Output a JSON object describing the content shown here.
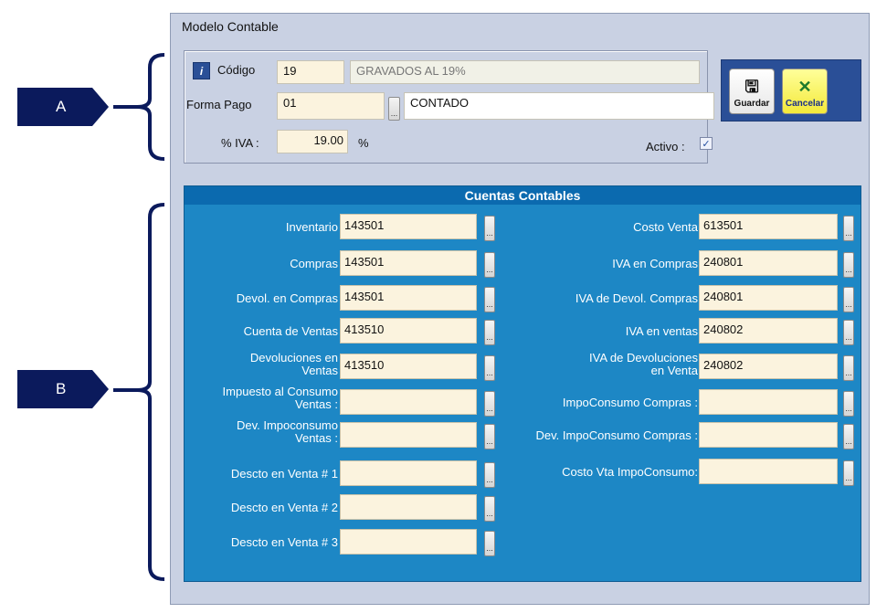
{
  "annotations": {
    "a": "A",
    "b": "B"
  },
  "window": {
    "title": "Modelo Contable"
  },
  "header": {
    "codigo_label": "Código",
    "codigo_value": "19",
    "codigo_desc": "GRAVADOS AL 19%",
    "forma_pago_label": "Forma Pago",
    "forma_pago_value": "01",
    "forma_pago_desc": "CONTADO",
    "iva_label": "% IVA :",
    "iva_value": "19.00",
    "iva_unit": "%",
    "activo_label": "Activo :",
    "activo_checked": true
  },
  "toolbar": {
    "save_label": "Guardar",
    "cancel_label": "Cancelar"
  },
  "cuentas": {
    "title": "Cuentas Contables",
    "left": [
      {
        "label": "Inventario",
        "value": "143501"
      },
      {
        "label": "Compras",
        "value": "143501"
      },
      {
        "label": "Devol. en Compras",
        "value": "143501"
      },
      {
        "label": "Cuenta de Ventas",
        "value": "413510"
      },
      {
        "label_1": "Devoluciones en",
        "label_2": "Ventas",
        "value": "413510"
      },
      {
        "label_1": "Impuesto al Consumo",
        "label_2": "Ventas :",
        "value": ""
      },
      {
        "label_1": "Dev. Impoconsumo",
        "label_2": "Ventas :",
        "value": ""
      },
      {
        "label": "Descto en Venta # 1",
        "value": ""
      },
      {
        "label": "Descto en Venta # 2",
        "value": ""
      },
      {
        "label": "Descto en Venta # 3",
        "value": ""
      }
    ],
    "right": [
      {
        "label": "Costo Venta",
        "value": "613501"
      },
      {
        "label": "IVA en Compras",
        "value": "240801"
      },
      {
        "label": "IVA de Devol. Compras",
        "value": "240801"
      },
      {
        "label": "IVA en ventas",
        "value": "240802"
      },
      {
        "label_1": "IVA de Devoluciones",
        "label_2": "en Venta",
        "value": "240802"
      },
      {
        "label": "ImpoConsumo Compras :",
        "value": ""
      },
      {
        "label": "Dev. ImpoConsumo Compras :",
        "value": ""
      },
      {
        "label": "Costo Vta ImpoConsumo:",
        "value": ""
      }
    ]
  }
}
